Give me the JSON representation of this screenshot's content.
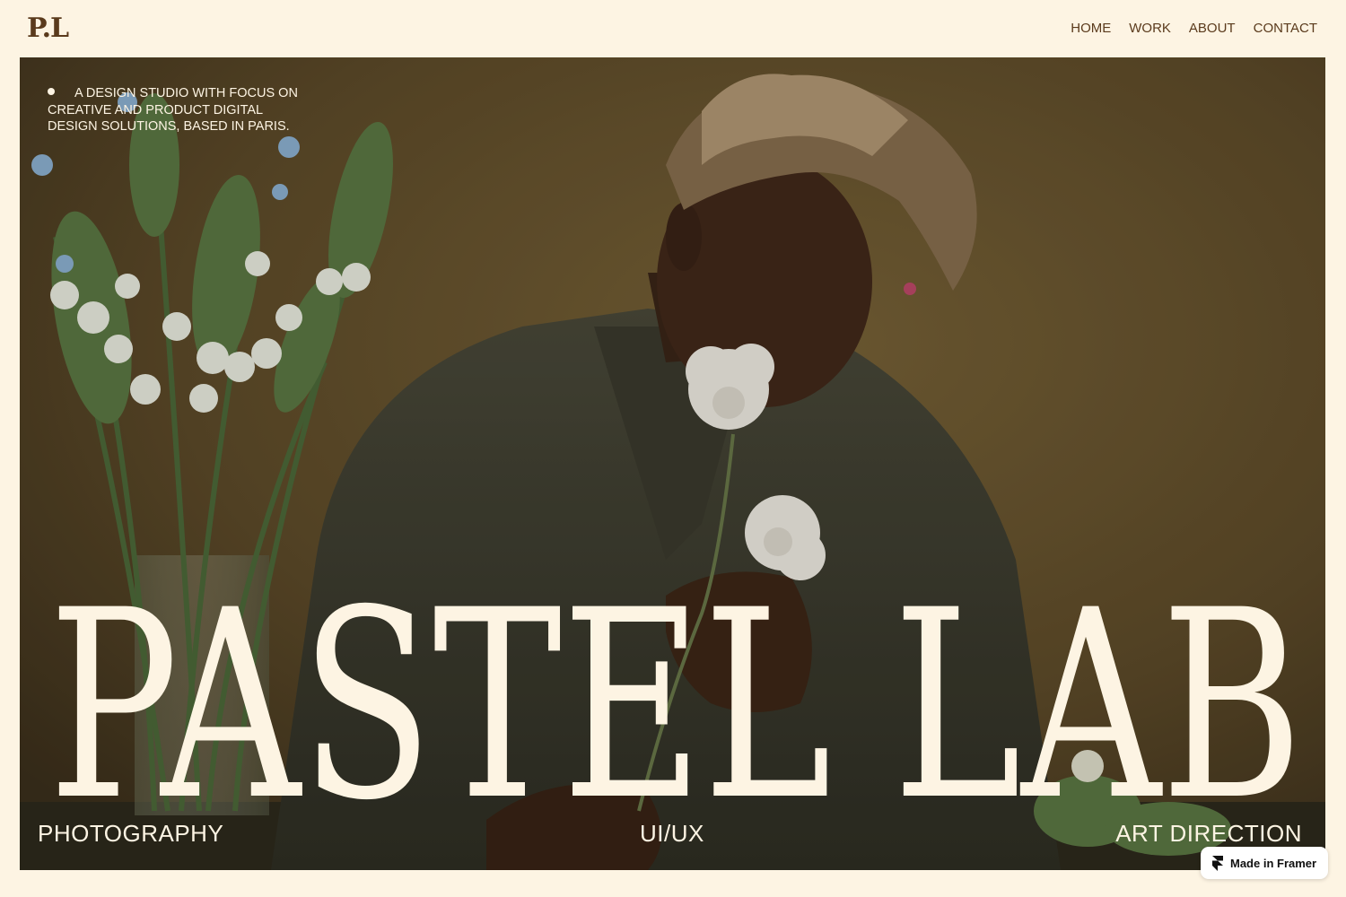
{
  "header": {
    "logo": "P.L",
    "nav": [
      "HOME",
      "WORK",
      "ABOUT",
      "CONTACT"
    ]
  },
  "hero": {
    "tagline": "A DESIGN STUDIO WITH FOCUS ON CREATIVE AND PRODUCT DIGITAL DESIGN SOLUTIONS, BASED IN PARIS.",
    "brand_title": "PASTEL LAB",
    "services": [
      "PHOTOGRAPHY",
      "UI/UX",
      "ART DIRECTION"
    ],
    "photo_alt": "Man smelling white flowers next to a vase of white blossoms"
  },
  "badge": {
    "label": "Made in Framer",
    "icon": "framer-logo-icon"
  },
  "colors": {
    "background": "#fdf4e3",
    "accent_brown": "#5a3a1c",
    "hero_text": "#fdf4e3"
  }
}
